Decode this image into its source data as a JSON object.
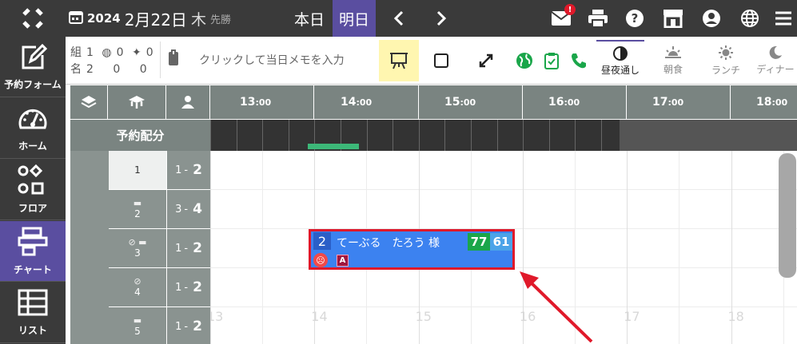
{
  "topbar": {
    "year": "2024",
    "month_day": "2月22日",
    "weekday": "木",
    "rokuyo": "先勝",
    "today_label": "本日",
    "tomorrow_label": "明日",
    "mail_badge": "!"
  },
  "sidebar": {
    "items": [
      {
        "label": "予約フォーム"
      },
      {
        "label": "ホーム"
      },
      {
        "label": "フロア"
      },
      {
        "label": "チャート"
      },
      {
        "label": "リスト"
      }
    ]
  },
  "toolbar": {
    "groups_label": "組",
    "groups": [
      "1",
      "0",
      "0"
    ],
    "people_label": "名",
    "people": [
      "2",
      "0",
      "0"
    ],
    "memo_placeholder": "クリックして当日メモを入力",
    "meals": [
      "昼夜通し",
      "朝食",
      "ランチ",
      "ディナー"
    ]
  },
  "chart": {
    "yoyaku_label": "予約配分",
    "times": [
      {
        "h": "13",
        "m": ":00"
      },
      {
        "h": "14",
        "m": ":00"
      },
      {
        "h": "15",
        "m": ":00"
      },
      {
        "h": "16",
        "m": ":00"
      },
      {
        "h": "17",
        "m": ":00"
      },
      {
        "h": "18",
        "m": ":00"
      }
    ],
    "faint_hours": [
      "13",
      "14",
      "15",
      "16",
      "17",
      "18"
    ],
    "tables": [
      {
        "name": "1",
        "cap_min": "1",
        "cap_max": "2"
      },
      {
        "name": "2",
        "cap_min": "3",
        "cap_max": "4"
      },
      {
        "name": "3",
        "cap_min": "1",
        "cap_max": "2"
      },
      {
        "name": "4",
        "cap_min": "1",
        "cap_max": "2"
      },
      {
        "name": "5",
        "cap_min": "1",
        "cap_max": "2"
      }
    ],
    "cap_sep": "-"
  },
  "reservation": {
    "count": "2",
    "name": "てーぶる　たろう 様",
    "badge_green": "77",
    "badge_blue": "61",
    "tag": "A",
    "colors": {
      "fill": "#3c82f0",
      "highlight": "#e0192a"
    }
  }
}
